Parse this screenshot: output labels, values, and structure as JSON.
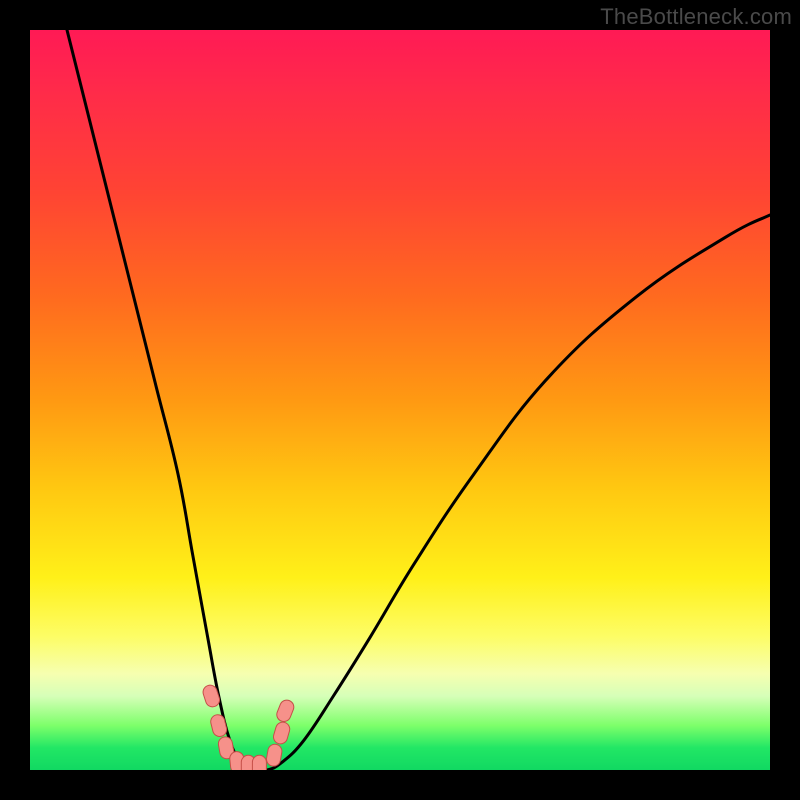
{
  "watermark": "TheBottleneck.com",
  "colors": {
    "curve": "#000000",
    "marker_fill": "#f6918a",
    "marker_stroke": "#c54f48",
    "gradient_top": "#ff1a55",
    "gradient_mid": "#ffc811",
    "gradient_bottom": "#11d862"
  },
  "chart_data": {
    "type": "line",
    "title": "",
    "xlabel": "",
    "ylabel": "",
    "xlim": [
      0,
      100
    ],
    "ylim": [
      0,
      100
    ],
    "grid": false,
    "legend": false,
    "note": "x ≈ relative hardware position (0–100). y ≈ bottleneck severity %, 0 = none (bottom/green), 100 = worst (top/red). Values estimated from pixel positions on a V-shaped bottleneck curve.",
    "series": [
      {
        "name": "bottleneck-curve",
        "x": [
          5,
          8,
          11,
          14,
          17,
          20,
          22,
          24,
          25.5,
          27,
          28.5,
          30,
          32,
          34,
          37,
          41,
          46,
          52,
          60,
          70,
          82,
          94,
          100
        ],
        "y": [
          100,
          88,
          76,
          64,
          52,
          40,
          29,
          18,
          10,
          4,
          1,
          0,
          0,
          1,
          4,
          10,
          18,
          28,
          40,
          53,
          64,
          72,
          75
        ]
      }
    ],
    "markers": {
      "name": "highlighted-points",
      "note": "Pink sausage-style markers near the curve minimum.",
      "points": [
        {
          "x": 24.5,
          "y": 10
        },
        {
          "x": 25.5,
          "y": 6
        },
        {
          "x": 26.5,
          "y": 3
        },
        {
          "x": 28.0,
          "y": 1
        },
        {
          "x": 29.5,
          "y": 0.5
        },
        {
          "x": 31.0,
          "y": 0.5
        },
        {
          "x": 33.0,
          "y": 2
        },
        {
          "x": 34.0,
          "y": 5
        },
        {
          "x": 34.5,
          "y": 8
        }
      ]
    }
  }
}
